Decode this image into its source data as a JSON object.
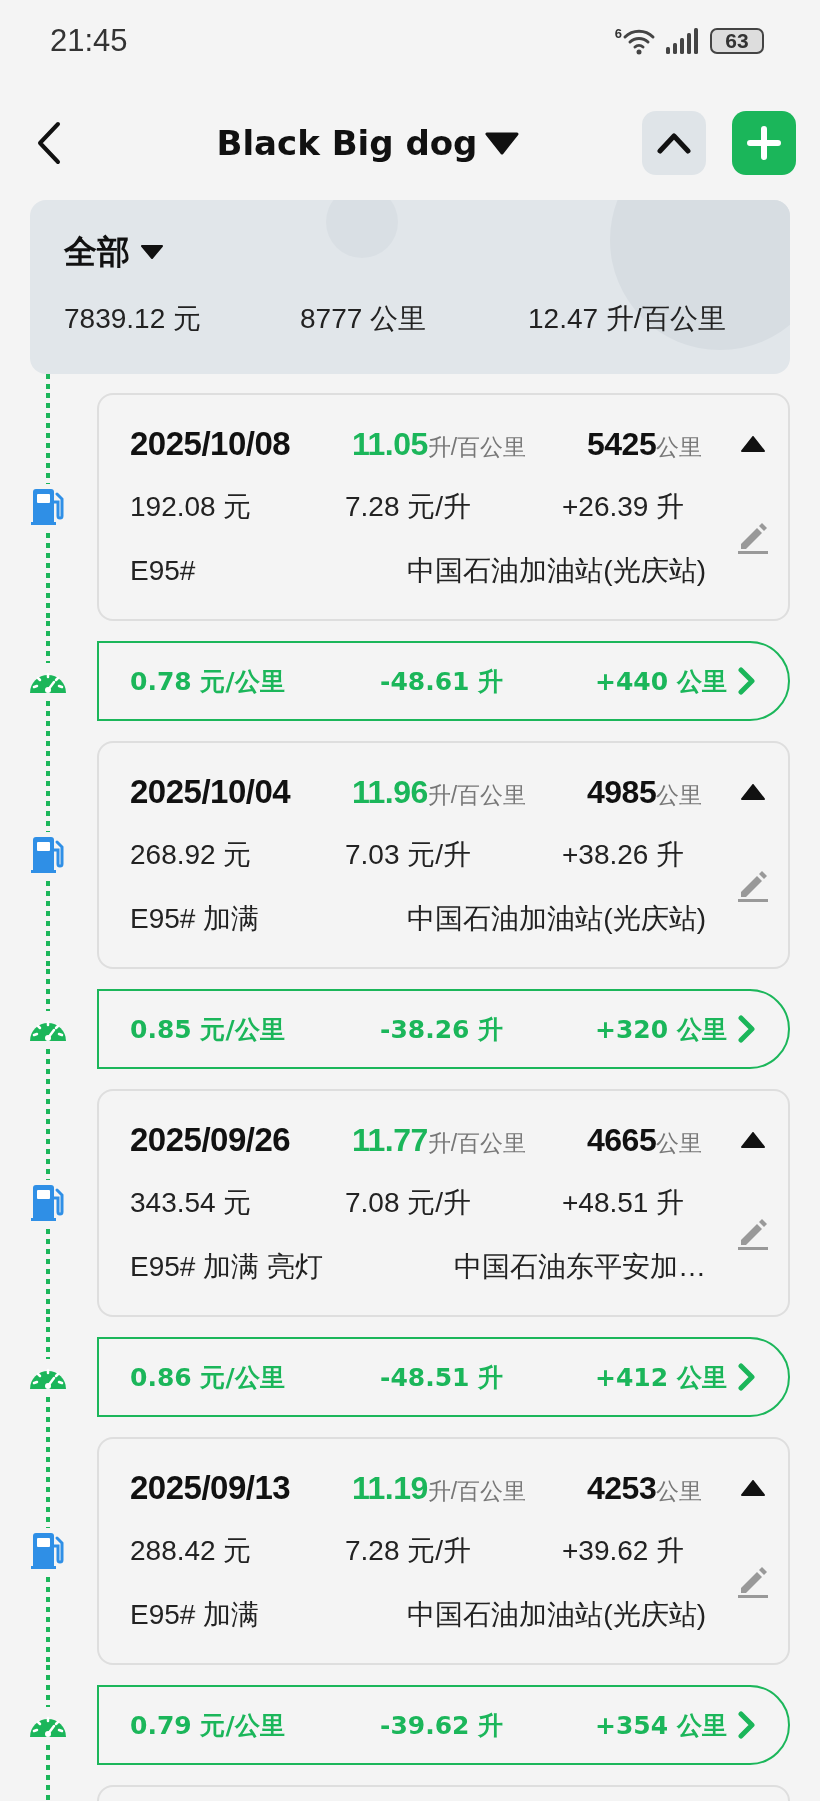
{
  "status_bar": {
    "time": "21:45",
    "wifi_label": "6",
    "battery": "63"
  },
  "header": {
    "title": "Black Big dog"
  },
  "summary": {
    "filter": "全部",
    "cost": "7839.12 元",
    "distance": "8777 公里",
    "consumption": "12.47 升/百公里"
  },
  "records": [
    {
      "kind": "fill",
      "date": "2025/10/08",
      "consumption": "11.05",
      "consumption_unit": "升/百公里",
      "odometer": "5425",
      "odometer_unit": "公里",
      "amount": "192.08 元",
      "price": "7.28 元/升",
      "volume": "+26.39 升",
      "tags": "E95#",
      "station": "中国石油加油站(光庆站)"
    },
    {
      "kind": "trip",
      "cost_per_km": "0.78 元/公里",
      "fuel": "-48.61 升",
      "distance": "+440 公里"
    },
    {
      "kind": "fill",
      "date": "2025/10/04",
      "consumption": "11.96",
      "consumption_unit": "升/百公里",
      "odometer": "4985",
      "odometer_unit": "公里",
      "amount": "268.92 元",
      "price": "7.03 元/升",
      "volume": "+38.26 升",
      "tags": "E95# 加满",
      "station": "中国石油加油站(光庆站)"
    },
    {
      "kind": "trip",
      "cost_per_km": "0.85 元/公里",
      "fuel": "-38.26 升",
      "distance": "+320 公里"
    },
    {
      "kind": "fill",
      "date": "2025/09/26",
      "consumption": "11.77",
      "consumption_unit": "升/百公里",
      "odometer": "4665",
      "odometer_unit": "公里",
      "amount": "343.54 元",
      "price": "7.08 元/升",
      "volume": "+48.51 升",
      "tags": "E95# 加满 亮灯",
      "station": "中国石油东平安加…"
    },
    {
      "kind": "trip",
      "cost_per_km": "0.86 元/公里",
      "fuel": "-48.51 升",
      "distance": "+412 公里"
    },
    {
      "kind": "fill",
      "date": "2025/09/13",
      "consumption": "11.19",
      "consumption_unit": "升/百公里",
      "odometer": "4253",
      "odometer_unit": "公里",
      "amount": "288.42 元",
      "price": "7.28 元/升",
      "volume": "+39.62 升",
      "tags": "E95# 加满",
      "station": "中国石油加油站(光庆站)"
    },
    {
      "kind": "trip",
      "cost_per_km": "0.79 元/公里",
      "fuel": "-39.62 升",
      "distance": "+354 公里"
    }
  ]
}
